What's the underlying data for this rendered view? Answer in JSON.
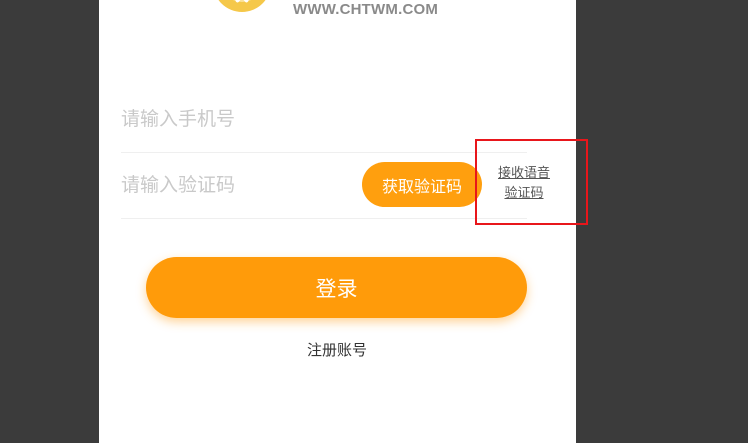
{
  "header": {
    "logo_icon": "brand-logo-icon",
    "site_url": "WWW.CHTWM.COM"
  },
  "form": {
    "phone_placeholder": "请输入手机号",
    "phone_value": "",
    "code_placeholder": "请输入验证码",
    "code_value": "",
    "get_code_label": "获取验证码",
    "voice_code_line1": "接收语音",
    "voice_code_line2": "验证码",
    "login_label": "登录",
    "register_label": "注册账号"
  },
  "colors": {
    "accent": "#ff9b0a",
    "logo": "#f5c84a",
    "highlight": "#e8161b",
    "backdrop": "#3b3b3b"
  }
}
